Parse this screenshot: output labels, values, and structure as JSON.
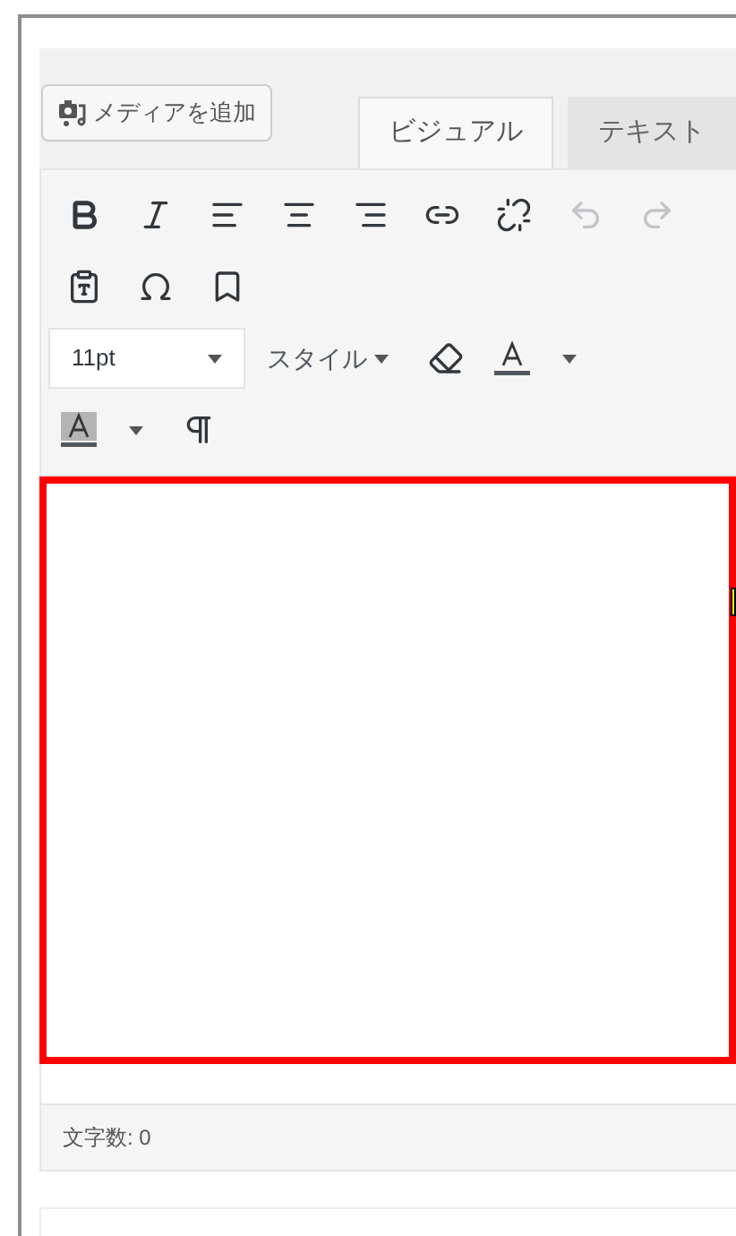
{
  "media_button": {
    "label": "メディアを追加"
  },
  "tabs": [
    {
      "label": "ビジュアル",
      "selected": true
    },
    {
      "label": "テキスト",
      "selected": false
    }
  ],
  "toolbar_rows": [
    [
      {
        "kind": "bold",
        "disabled": false
      },
      {
        "kind": "italic",
        "disabled": false
      },
      {
        "kind": "alignleft",
        "disabled": false
      },
      {
        "kind": "aligncenter",
        "disabled": false
      },
      {
        "kind": "alignright",
        "disabled": false
      },
      {
        "kind": "link",
        "disabled": false
      },
      {
        "kind": "unlink",
        "disabled": false
      },
      {
        "kind": "undo",
        "disabled": true
      },
      {
        "kind": "redo",
        "disabled": true
      }
    ],
    [
      {
        "kind": "paste",
        "disabled": false
      },
      {
        "kind": "omega",
        "disabled": false
      },
      {
        "kind": "bookmark",
        "disabled": false
      }
    ],
    [
      {
        "kind": "fontsize",
        "value": "11pt"
      },
      {
        "kind": "style",
        "label": "スタイル"
      },
      {
        "kind": "eraser",
        "disabled": false
      },
      {
        "kind": "textcolor",
        "disabled": false
      },
      {
        "kind": "caret",
        "disabled": false
      }
    ],
    [
      {
        "kind": "bgcolor",
        "disabled": false
      },
      {
        "kind": "caret",
        "disabled": false
      },
      {
        "kind": "pilcrow",
        "disabled": false
      }
    ]
  ],
  "status_bar": {
    "word_count": "文字数: 0"
  }
}
